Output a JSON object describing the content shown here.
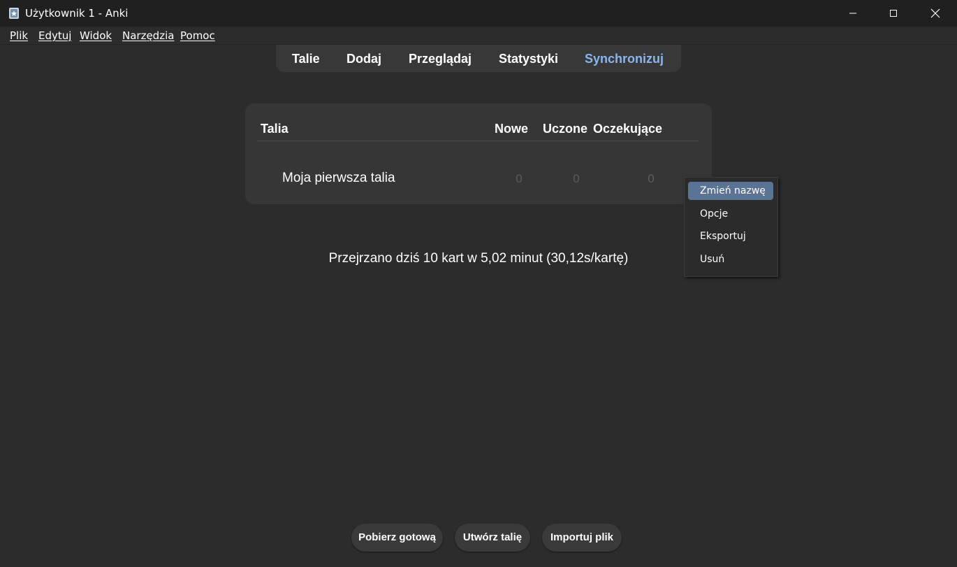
{
  "window": {
    "title": "Użytkownik 1 - Anki",
    "controls": {
      "minimize_icon": "minimize-icon",
      "maximize_icon": "maximize-icon",
      "close_icon": "close-icon"
    }
  },
  "menubar": {
    "items": [
      {
        "label": "Plik"
      },
      {
        "label": "Edytuj"
      },
      {
        "label": "Widok"
      },
      {
        "label": "Narzędzia"
      },
      {
        "label": "Pomoc"
      }
    ]
  },
  "toolbar": {
    "buttons": [
      {
        "label": "Talie"
      },
      {
        "label": "Dodaj"
      },
      {
        "label": "Przeglądaj"
      },
      {
        "label": "Statystyki"
      },
      {
        "label": "Synchronizuj"
      }
    ],
    "sync_color": "#8ab6ee"
  },
  "deck_table": {
    "headers": {
      "deck": "Talia",
      "new": "Nowe",
      "learn": "Uczone",
      "due": "Oczekujące"
    },
    "rows": [
      {
        "name": "Moja pierwsza talia",
        "new": "0",
        "learn": "0",
        "due": "0"
      }
    ]
  },
  "stats": {
    "text": "Przejrzano dziś 10 kart w 5,02 minut (30,12s/kartę)"
  },
  "context_menu": {
    "items": [
      {
        "label": "Zmień nazwę",
        "highlighted": true
      },
      {
        "label": "Opcje"
      },
      {
        "label": "Eksportuj"
      },
      {
        "label": "Usuń"
      }
    ],
    "highlight_color": "#5b7394"
  },
  "bottom_buttons": {
    "download": "Pobierz gotową",
    "create": "Utwórz talię",
    "import": "Importuj plik"
  }
}
